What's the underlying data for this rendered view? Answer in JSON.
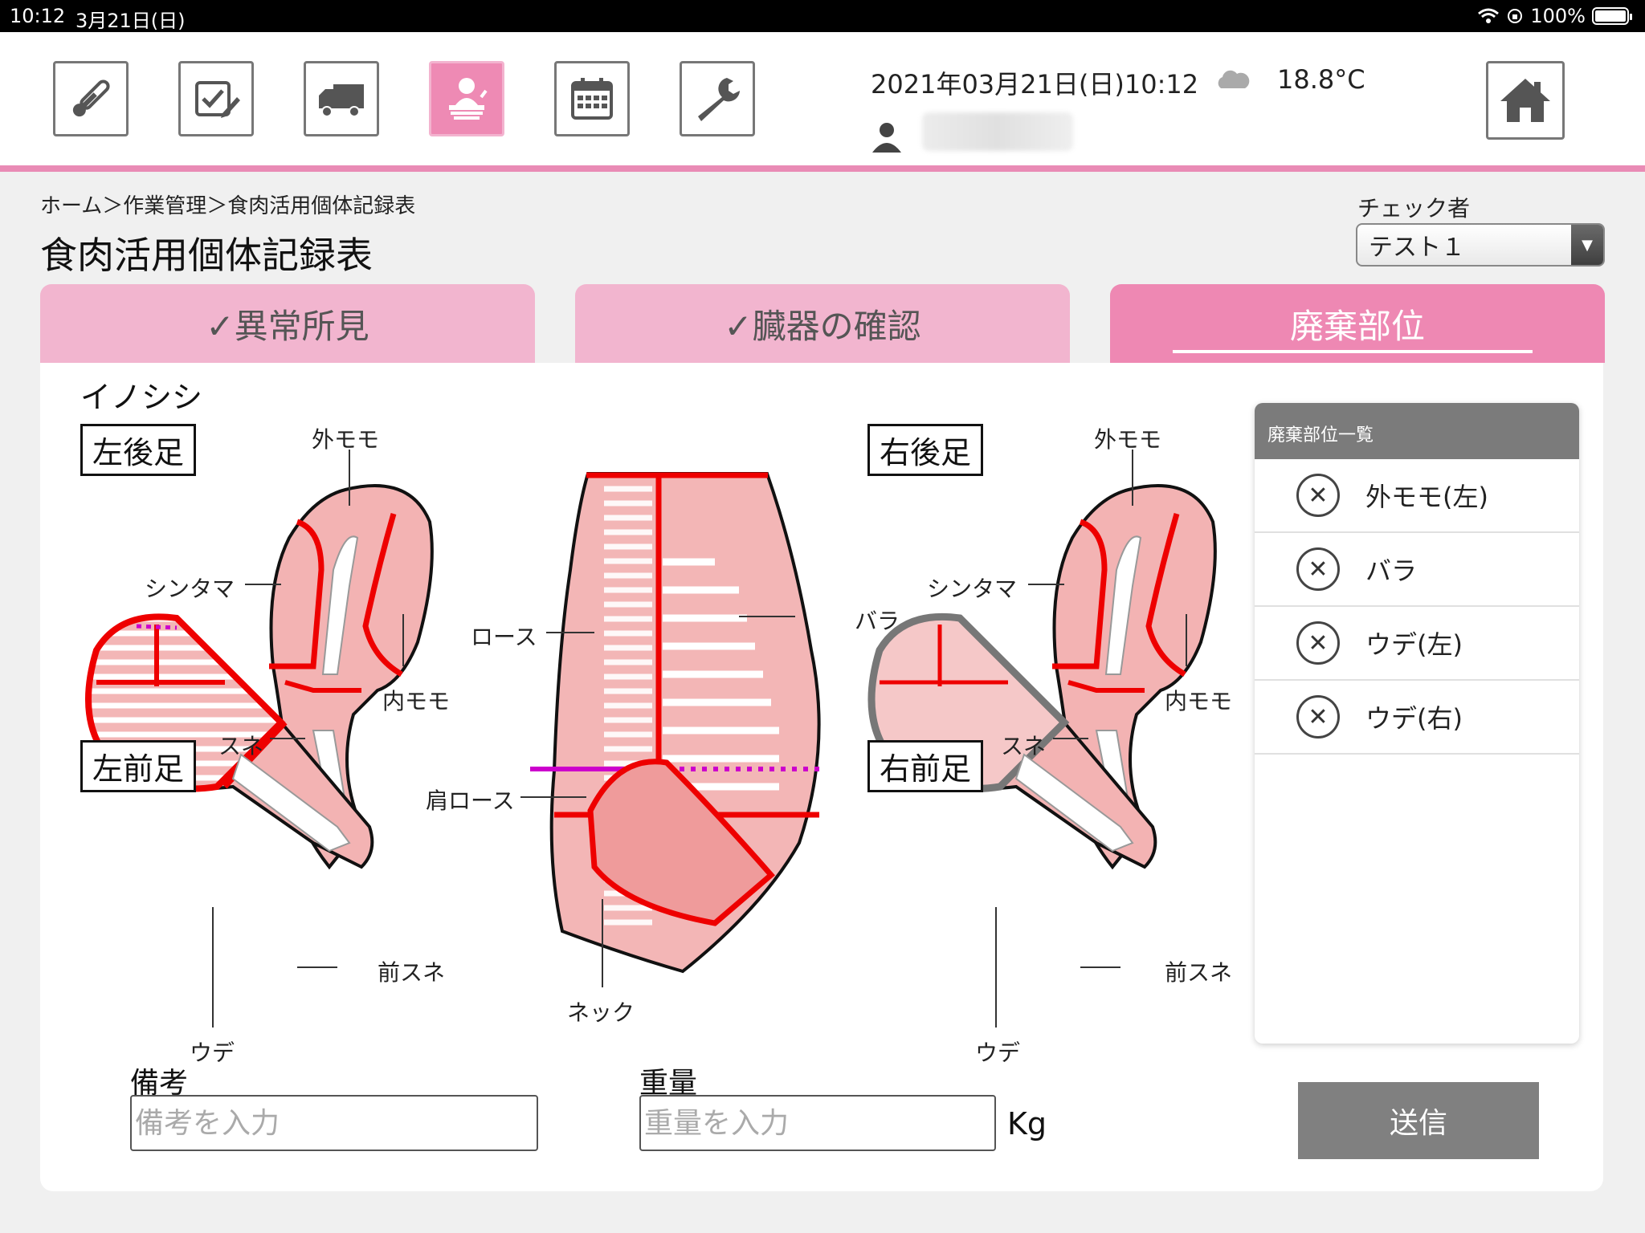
{
  "status_bar": {
    "time": "10:12",
    "date": "3月21日(日)",
    "battery": "100%",
    "battery_level": 1.0
  },
  "header": {
    "datetime": "2021年03月21日(日)10:12",
    "weather_icon": "cloud-icon",
    "temperature": "18.8°C",
    "nav_icons": [
      "thermometer-icon",
      "checklist-icon",
      "truck-icon",
      "worker-icon",
      "calendar-icon",
      "wrench-icon"
    ],
    "active_nav": "worker-icon",
    "home_icon": "home-icon"
  },
  "breadcrumb": "ホーム＞作業管理＞食肉活用個体記録表",
  "page_title": "食肉活用個体記録表",
  "checker": {
    "label": "チェック者",
    "value": "テスト１"
  },
  "tabs": [
    {
      "label": "✓異常所見",
      "active": false
    },
    {
      "label": "✓臓器の確認",
      "active": false
    },
    {
      "label": "廃棄部位",
      "active": true
    }
  ],
  "animal": "イノシシ",
  "diagram": {
    "left_hind": "左後足",
    "right_hind": "右後足",
    "left_fore": "左前足",
    "right_fore": "右前足",
    "parts": {
      "soto_momo": "外モモ",
      "shintama": "シンタマ",
      "uchi_momo": "内モモ",
      "sune": "スネ",
      "roast": "ロース",
      "bara": "バラ",
      "kata_roast": "肩ロース",
      "neck": "ネック",
      "mae_sune": "前スネ",
      "ude": "ウデ"
    }
  },
  "waste_list": {
    "title": "廃棄部位一覧",
    "items": [
      "外モモ(左)",
      "バラ",
      "ウデ(左)",
      "ウデ(右)"
    ]
  },
  "form": {
    "remarks_label": "備考",
    "remarks_placeholder": "備考を入力",
    "weight_label": "重量",
    "weight_placeholder": "重量を入力",
    "weight_unit": "Kg",
    "submit": "送信"
  }
}
